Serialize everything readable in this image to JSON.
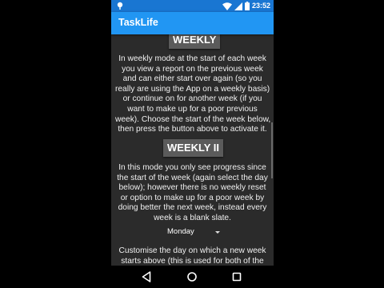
{
  "status_bar": {
    "time": "23:52",
    "icons": [
      "notification-dot-icon",
      "wifi-icon",
      "signal-icon",
      "battery-icon"
    ]
  },
  "app_bar": {
    "title": "TaskLife"
  },
  "sections": [
    {
      "heading": "WEEKLY",
      "lines": [
        "In weekly mode at the start of each week",
        "you view a report on the previous week",
        "and can either start over again (so you",
        "really are using the App on a weekly basis)",
        "or continue on for another week (if you",
        "want to make up for a poor previous",
        "week). Choose the start of the week below,",
        "then press the button above to activate it."
      ]
    },
    {
      "heading": "WEEKLY II",
      "lines": [
        "In this mode you only see progress since",
        "the start of the week (again select the day",
        "below); however there is no weekly reset",
        "or option to make up for a poor week by",
        "doing better the next week, instead every",
        "week is a blank slate."
      ]
    }
  ],
  "day_select": {
    "value": "Monday"
  },
  "footer_text": {
    "lines": [
      "Customise the day on which a new week",
      "starts above (this is used for both of the"
    ]
  },
  "colors": {
    "status_bar": "#1976d2",
    "app_bar": "#2196f3",
    "background": "#2b2b2b",
    "heading_button": "#5b5b5b"
  },
  "nav": {
    "icons": [
      "back-icon",
      "home-icon",
      "recents-icon"
    ]
  }
}
